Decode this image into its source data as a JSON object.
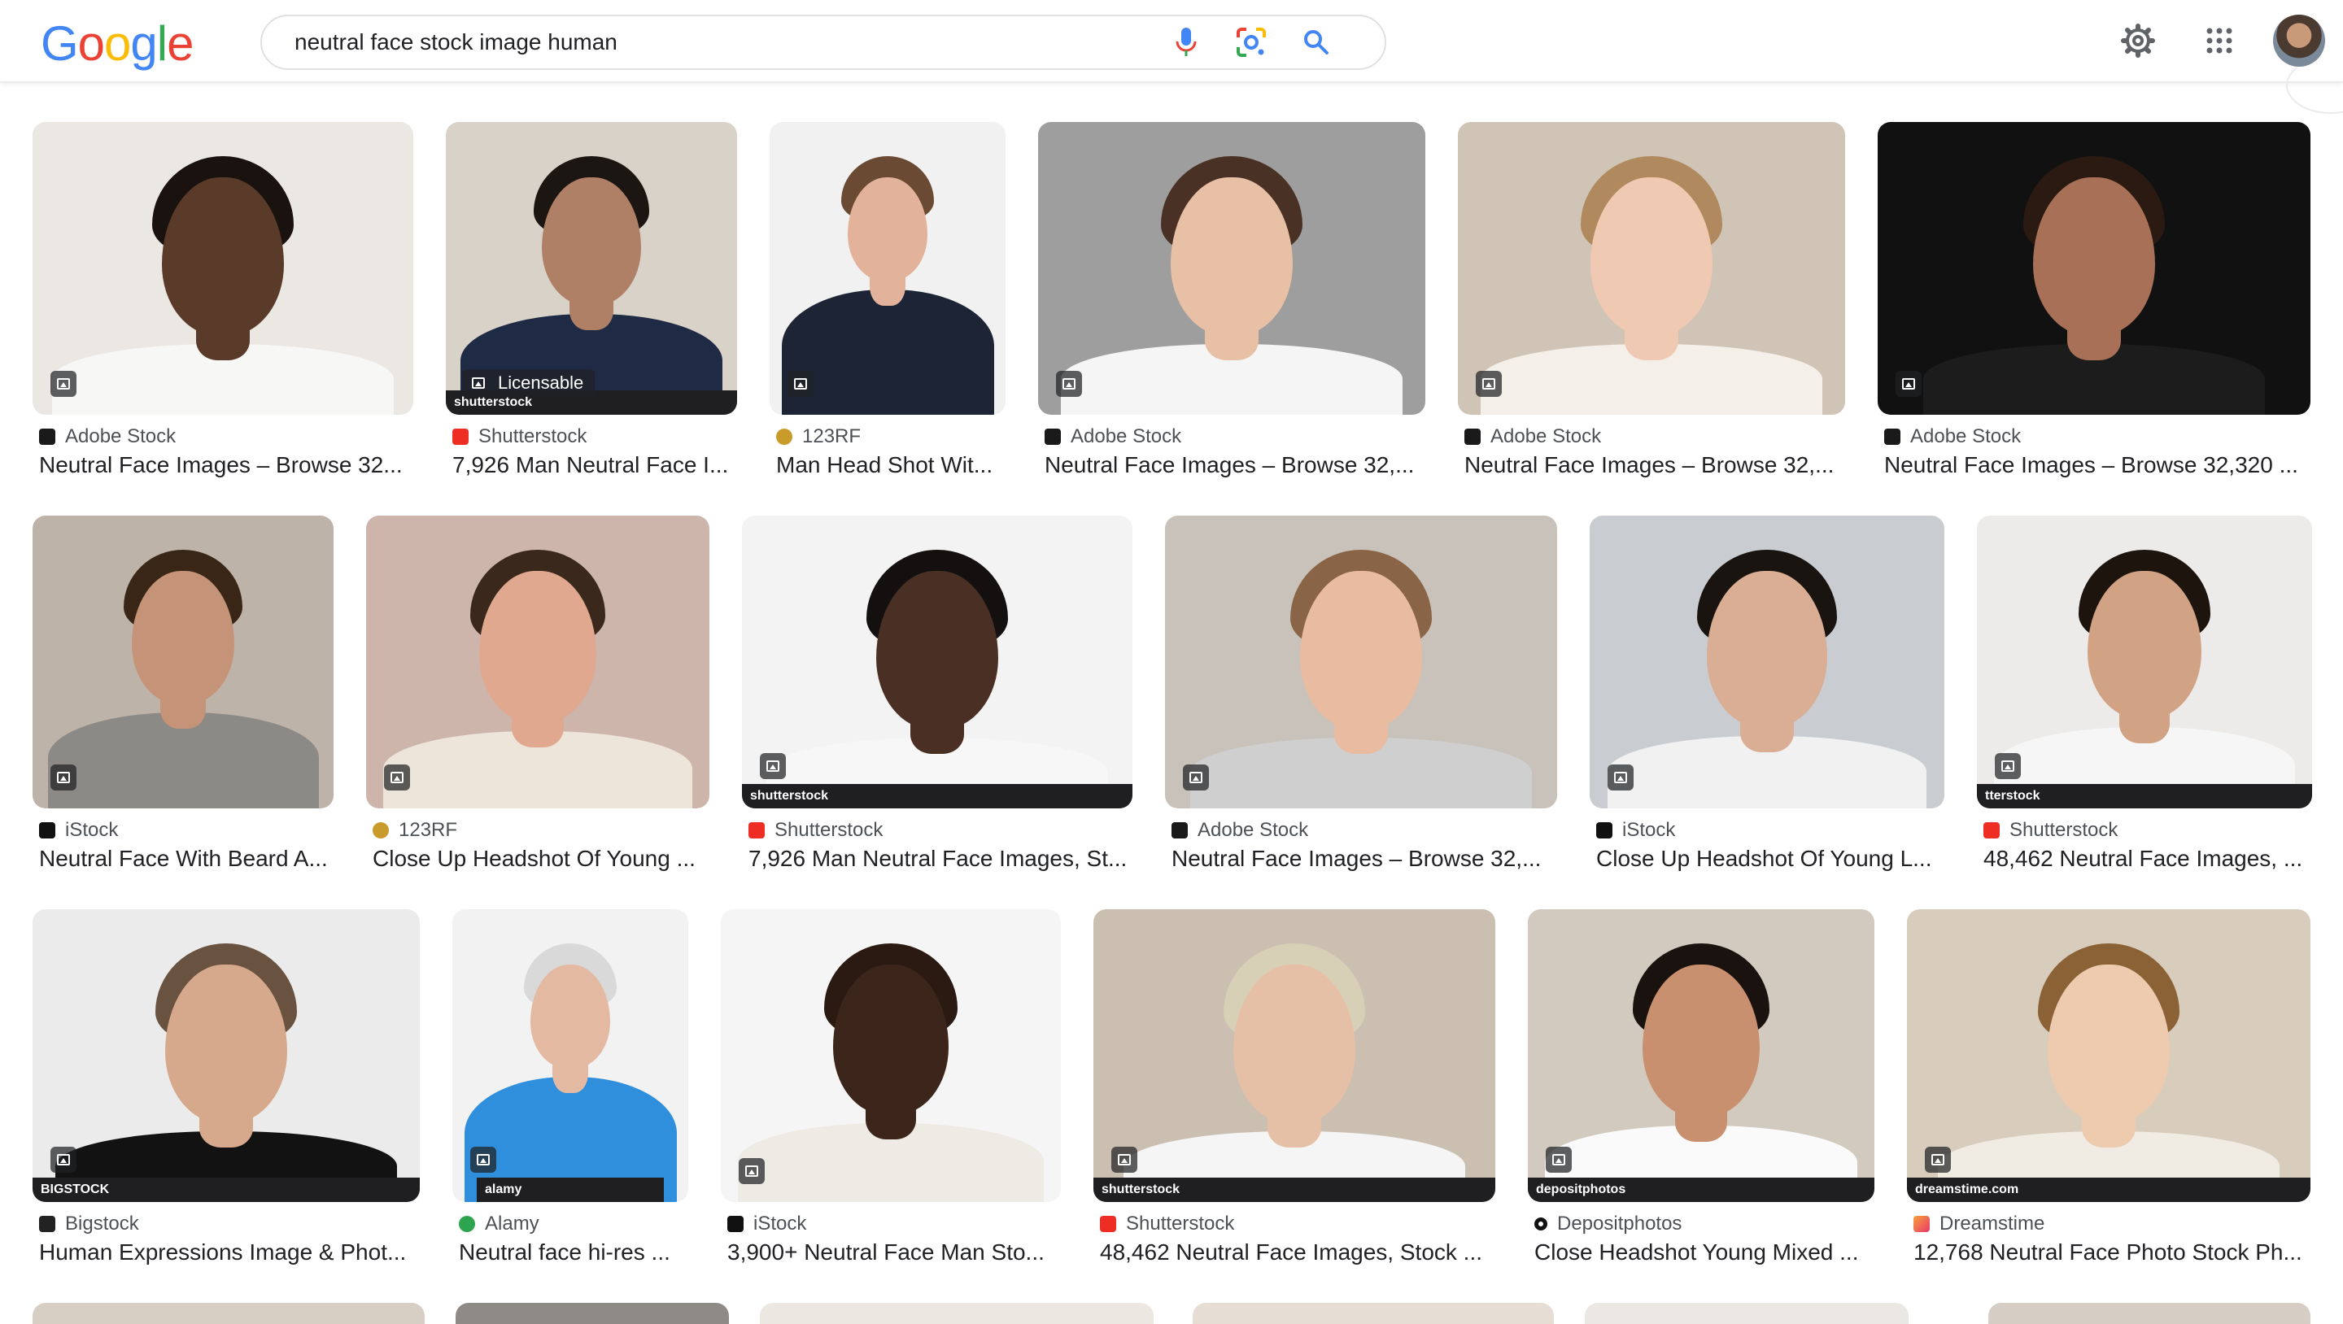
{
  "header": {
    "logo_letters": [
      {
        "ch": "G",
        "color": "#4285F4"
      },
      {
        "ch": "o",
        "color": "#EA4335"
      },
      {
        "ch": "o",
        "color": "#FBBC05"
      },
      {
        "ch": "g",
        "color": "#4285F4"
      },
      {
        "ch": "l",
        "color": "#34A853"
      },
      {
        "ch": "e",
        "color": "#EA4335"
      }
    ],
    "search_query": "neutral face stock image human",
    "icons": [
      "mic-icon",
      "lens-icon",
      "search-icon",
      "gear-icon",
      "apps-icon",
      "avatar"
    ]
  },
  "sources": {
    "Adobe Stock": "#1a1a1a",
    "Shutterstock": "#ee2e24",
    "123RF": "#c99b2a",
    "iStock": "#111111",
    "Bigstock": "#222222",
    "Alamy": "#2ea44f",
    "Depositphotos": "#111111",
    "Dreamstime": "#e8396b"
  },
  "results": [
    {
      "source": "Adobe Stock",
      "title": "Neutral Face Images – Browse 32..."
    },
    {
      "source": "Shutterstock",
      "title": "7,926 Man Neutral Face I...",
      "badge": "Licensable",
      "watermark": "shutterstock"
    },
    {
      "source": "123RF",
      "title": "Man Head Shot Wit..."
    },
    {
      "source": "Adobe Stock",
      "title": "Neutral Face Images – Browse 32,..."
    },
    {
      "source": "Adobe Stock",
      "title": "Neutral Face Images – Browse 32,..."
    },
    {
      "source": "Adobe Stock",
      "title": "Neutral Face Images – Browse 32,320 ..."
    },
    {
      "source": "iStock",
      "title": "Neutral Face With Beard A..."
    },
    {
      "source": "123RF",
      "title": "Close Up Headshot Of Young ..."
    },
    {
      "source": "Shutterstock",
      "title": "7,926 Man Neutral Face Images, St...",
      "watermark": "shutterstock"
    },
    {
      "source": "Adobe Stock",
      "title": "Neutral Face Images – Browse 32,..."
    },
    {
      "source": "iStock",
      "title": "Close Up Headshot Of Young L..."
    },
    {
      "source": "Shutterstock",
      "title": "48,462 Neutral Face Images, ...",
      "watermark": "tterstock"
    },
    {
      "source": "Bigstock",
      "title": "Human Expressions Image & Phot...",
      "watermark": "BIGSTOCK"
    },
    {
      "source": "Alamy",
      "title": "Neutral face hi-res ...",
      "watermark": "alamy"
    },
    {
      "source": "iStock",
      "title": "3,900+ Neutral Face Man Sto..."
    },
    {
      "source": "Shutterstock",
      "title": "48,462 Neutral Face Images, Stock ...",
      "watermark": "shutterstock"
    },
    {
      "source": "Depositphotos",
      "title": "Close Headshot Young Mixed ...",
      "watermark": "depositphotos"
    },
    {
      "source": "Dreamstime",
      "title": "12,768 Neutral Face Photo Stock Ph...",
      "watermark": "dreamstime.com"
    }
  ]
}
